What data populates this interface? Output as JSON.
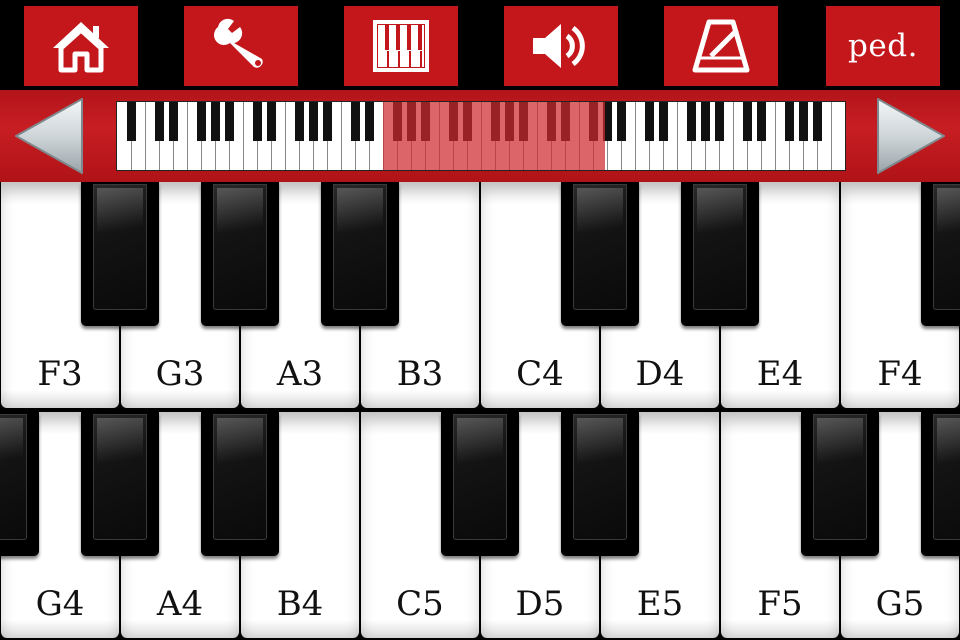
{
  "toolbar": {
    "buttons": [
      {
        "name": "home-button",
        "icon": "home-icon"
      },
      {
        "name": "settings-button",
        "icon": "wrench-icon"
      },
      {
        "name": "keyboard-layout-button",
        "icon": "piano-keys-icon"
      },
      {
        "name": "sound-button",
        "icon": "speaker-icon"
      },
      {
        "name": "metronome-button",
        "icon": "metronome-icon"
      }
    ],
    "ped_label": "ped."
  },
  "range_bar": {
    "left_arrow_icon": "left-arrow-icon",
    "right_arrow_icon": "right-arrow-icon",
    "selection_start_fraction": 0.365,
    "selection_end_fraction": 0.67
  },
  "keyboard": {
    "row1": {
      "white_keys": [
        "F3",
        "G3",
        "A3",
        "B3",
        "C4",
        "D4",
        "E4",
        "F4"
      ],
      "black_keys_after_index": [
        0,
        1,
        2,
        4,
        5,
        7
      ]
    },
    "row2": {
      "white_keys": [
        "G4",
        "A4",
        "B4",
        "C5",
        "D5",
        "E5",
        "F5",
        "G5"
      ],
      "black_keys_after_index": [
        -1,
        0,
        1,
        3,
        4,
        6,
        7
      ]
    }
  },
  "colors": {
    "accent_red": "#c3171c",
    "selection_red": "#ce2a30"
  }
}
